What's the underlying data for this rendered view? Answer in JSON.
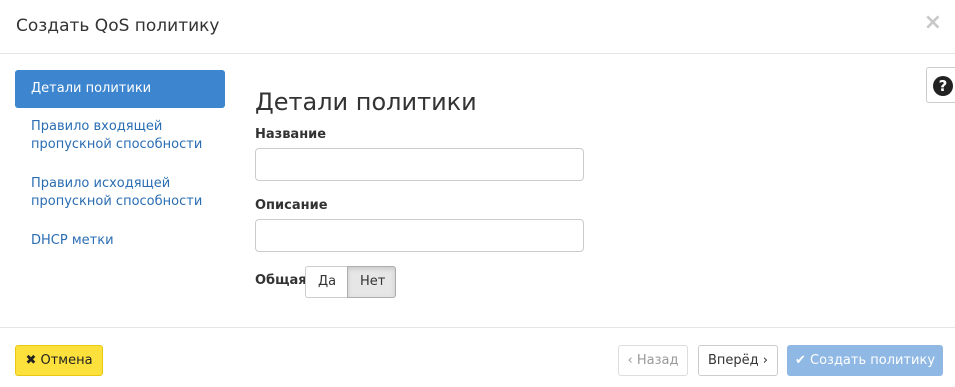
{
  "header": {
    "title": "Создать QoS политику",
    "close_glyph": "×"
  },
  "nav": {
    "items": [
      {
        "label": "Детали политики",
        "active": true
      },
      {
        "label": "Правило входящей пропускной способности",
        "active": false
      },
      {
        "label": "Правило исходящей пропускной способности",
        "active": false
      },
      {
        "label": "DHCP метки",
        "active": false
      }
    ]
  },
  "help": {
    "icon": "question-circle-icon",
    "glyph": "?"
  },
  "form": {
    "section_title": "Детали политики",
    "name_label": "Название",
    "name_value": "",
    "description_label": "Описание",
    "description_value": "",
    "shared_label": "Общая",
    "shared_options": [
      "Да",
      "Нет"
    ],
    "shared_selected": "Нет"
  },
  "footer": {
    "cancel_icon": "✖",
    "cancel_label": "Отмена",
    "back_icon": "‹",
    "back_label": "Назад",
    "next_label": "Вперёд",
    "next_icon": "›",
    "create_icon": "✔",
    "create_label": "Создать политику"
  },
  "colors": {
    "accent": "#3d86cf",
    "cancel": "#fce13c",
    "create_disabled": "#8fb8e5",
    "link": "#2a6db3"
  }
}
